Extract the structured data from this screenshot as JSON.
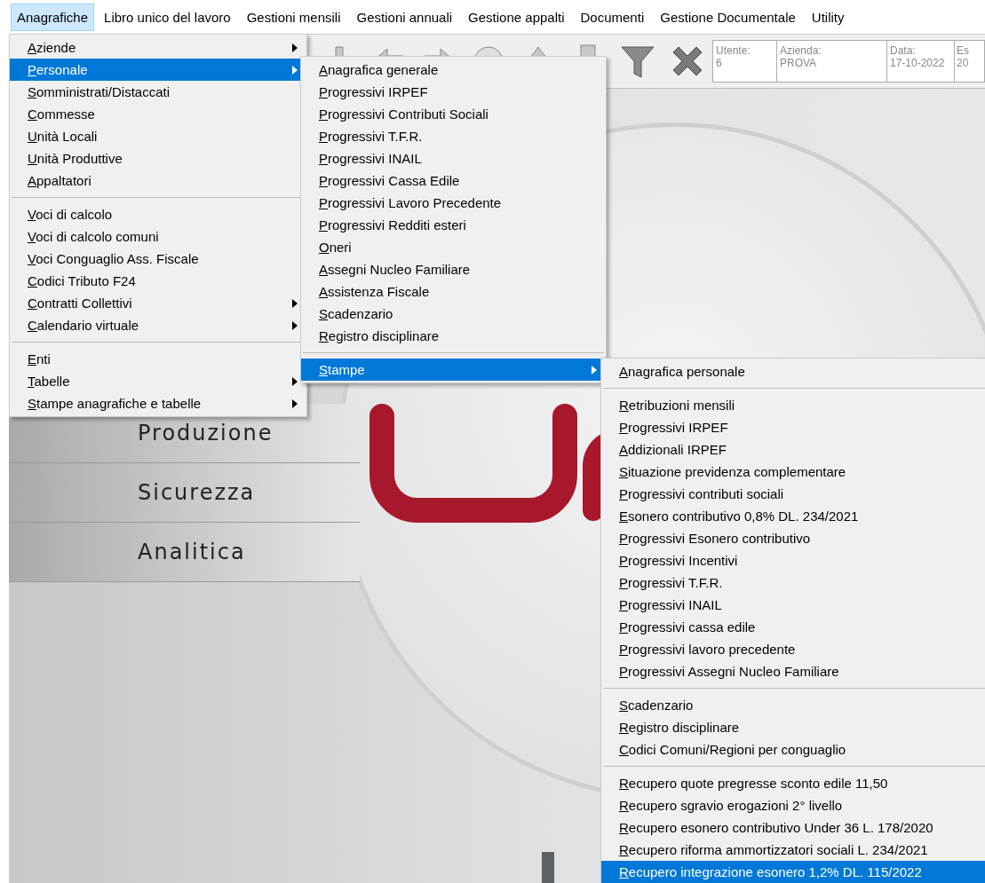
{
  "menu_bar": [
    {
      "label": "Anagrafiche",
      "selected": true
    },
    {
      "label": "Libro unico del lavoro",
      "selected": false
    },
    {
      "label": "Gestioni mensili",
      "selected": false
    },
    {
      "label": "Gestioni annuali",
      "selected": false
    },
    {
      "label": "Gestione appalti",
      "selected": false
    },
    {
      "label": "Documenti",
      "selected": false
    },
    {
      "label": "Gestione Documentale",
      "selected": false
    },
    {
      "label": "Utility",
      "selected": false
    }
  ],
  "info_fields": [
    {
      "label": "Utente:",
      "value": "6"
    },
    {
      "label": "Azienda:",
      "value": "PROVA"
    },
    {
      "label": "Data:",
      "value": "17-10-2022"
    },
    {
      "label": "Es",
      "value": "20"
    }
  ],
  "side_sections": [
    "Produzione",
    "Sicurezza",
    "Analitica"
  ],
  "menus": [
    {
      "items": [
        {
          "kind": "item",
          "label": "Aziende",
          "submenu": true,
          "selected": false
        },
        {
          "kind": "item",
          "label": "Personale",
          "submenu": true,
          "selected": true
        },
        {
          "kind": "item",
          "label": "Somministrati/Distaccati",
          "submenu": false,
          "selected": false
        },
        {
          "kind": "item",
          "label": "Commesse",
          "submenu": false,
          "selected": false
        },
        {
          "kind": "item",
          "label": "Unità Locali",
          "submenu": false,
          "selected": false
        },
        {
          "kind": "item",
          "label": "Unità Produttive",
          "submenu": false,
          "selected": false
        },
        {
          "kind": "item",
          "label": "Appaltatori",
          "submenu": false,
          "selected": false
        },
        {
          "kind": "separator"
        },
        {
          "kind": "item",
          "label": "Voci di calcolo",
          "submenu": false,
          "selected": false
        },
        {
          "kind": "item",
          "label": "Voci di calcolo comuni",
          "submenu": false,
          "selected": false
        },
        {
          "kind": "item",
          "label": "Voci Conguaglio Ass. Fiscale",
          "submenu": false,
          "selected": false
        },
        {
          "kind": "item",
          "label": "Codici Tributo F24",
          "submenu": false,
          "selected": false
        },
        {
          "kind": "item",
          "label": "Contratti Collettivi",
          "submenu": true,
          "selected": false
        },
        {
          "kind": "item",
          "label": "Calendario virtuale",
          "submenu": true,
          "selected": false
        },
        {
          "kind": "separator"
        },
        {
          "kind": "item",
          "label": "Enti",
          "submenu": false,
          "selected": false
        },
        {
          "kind": "item",
          "label": "Tabelle",
          "submenu": true,
          "selected": false
        },
        {
          "kind": "item",
          "label": "Stampe anagrafiche e tabelle",
          "submenu": true,
          "selected": false
        }
      ]
    },
    {
      "items": [
        {
          "kind": "item",
          "label": "Anagrafica generale",
          "submenu": false,
          "selected": false
        },
        {
          "kind": "item",
          "label": "Progressivi IRPEF",
          "submenu": false,
          "selected": false
        },
        {
          "kind": "item",
          "label": "Progressivi Contributi Sociali",
          "submenu": false,
          "selected": false
        },
        {
          "kind": "item",
          "label": "Progressivi T.F.R.",
          "submenu": false,
          "selected": false
        },
        {
          "kind": "item",
          "label": "Progressivi INAIL",
          "submenu": false,
          "selected": false
        },
        {
          "kind": "item",
          "label": "Progressivi Cassa Edile",
          "submenu": false,
          "selected": false
        },
        {
          "kind": "item",
          "label": "Progressivi Lavoro Precedente",
          "submenu": false,
          "selected": false
        },
        {
          "kind": "item",
          "label": "Progressivi Redditi esteri",
          "submenu": false,
          "selected": false
        },
        {
          "kind": "item",
          "label": "Oneri",
          "submenu": false,
          "selected": false
        },
        {
          "kind": "item",
          "label": "Assegni Nucleo Familiare",
          "submenu": false,
          "selected": false
        },
        {
          "kind": "item",
          "label": "Assistenza Fiscale",
          "submenu": false,
          "selected": false
        },
        {
          "kind": "item",
          "label": "Scadenzario",
          "submenu": false,
          "selected": false
        },
        {
          "kind": "item",
          "label": "Registro disciplinare",
          "submenu": false,
          "selected": false
        },
        {
          "kind": "separator"
        },
        {
          "kind": "item",
          "label": "Stampe",
          "submenu": true,
          "selected": true
        }
      ]
    },
    {
      "items": [
        {
          "kind": "item",
          "label": "Anagrafica personale",
          "submenu": false,
          "selected": false
        },
        {
          "kind": "separator"
        },
        {
          "kind": "item",
          "label": "Retribuzioni mensili",
          "submenu": false,
          "selected": false
        },
        {
          "kind": "item",
          "label": "Progressivi IRPEF",
          "submenu": false,
          "selected": false
        },
        {
          "kind": "item",
          "label": "Addizionali IRPEF",
          "submenu": false,
          "selected": false
        },
        {
          "kind": "item",
          "label": "Situazione previdenza complementare",
          "submenu": false,
          "selected": false
        },
        {
          "kind": "item",
          "label": "Progressivi contributi sociali",
          "submenu": false,
          "selected": false
        },
        {
          "kind": "item",
          "label": "Esonero contributivo 0,8% DL. 234/2021",
          "submenu": false,
          "selected": false
        },
        {
          "kind": "item",
          "label": "Progressivi Esonero contributivo",
          "submenu": false,
          "selected": false
        },
        {
          "kind": "item",
          "label": "Progressivi Incentivi",
          "submenu": false,
          "selected": false
        },
        {
          "kind": "item",
          "label": "Progressivi T.F.R.",
          "submenu": false,
          "selected": false
        },
        {
          "kind": "item",
          "label": "Progressivi INAIL",
          "submenu": false,
          "selected": false
        },
        {
          "kind": "item",
          "label": "Progressivi cassa edile",
          "submenu": false,
          "selected": false
        },
        {
          "kind": "item",
          "label": "Progressivi lavoro precedente",
          "submenu": false,
          "selected": false
        },
        {
          "kind": "item",
          "label": "Progressivi Assegni Nucleo Familiare",
          "submenu": false,
          "selected": false
        },
        {
          "kind": "separator"
        },
        {
          "kind": "item",
          "label": "Scadenzario",
          "submenu": false,
          "selected": false
        },
        {
          "kind": "item",
          "label": "Registro disciplinare",
          "submenu": false,
          "selected": false
        },
        {
          "kind": "item",
          "label": "Codici Comuni/Regioni per conguaglio",
          "submenu": false,
          "selected": false
        },
        {
          "kind": "separator"
        },
        {
          "kind": "item",
          "label": "Recupero quote pregresse sconto edile 11,50",
          "submenu": false,
          "selected": false
        },
        {
          "kind": "item",
          "label": "Recupero sgravio erogazioni 2° livello",
          "submenu": false,
          "selected": false
        },
        {
          "kind": "item",
          "label": "Recupero esonero contributivo Under 36 L. 178/2020",
          "submenu": false,
          "selected": false
        },
        {
          "kind": "item",
          "label": "Recupero riforma ammortizzatori sociali L. 234/2021",
          "submenu": false,
          "selected": false
        },
        {
          "kind": "item",
          "label": "Recupero integrazione esonero 1,2% DL. 115/2022",
          "submenu": false,
          "selected": true
        }
      ]
    }
  ]
}
